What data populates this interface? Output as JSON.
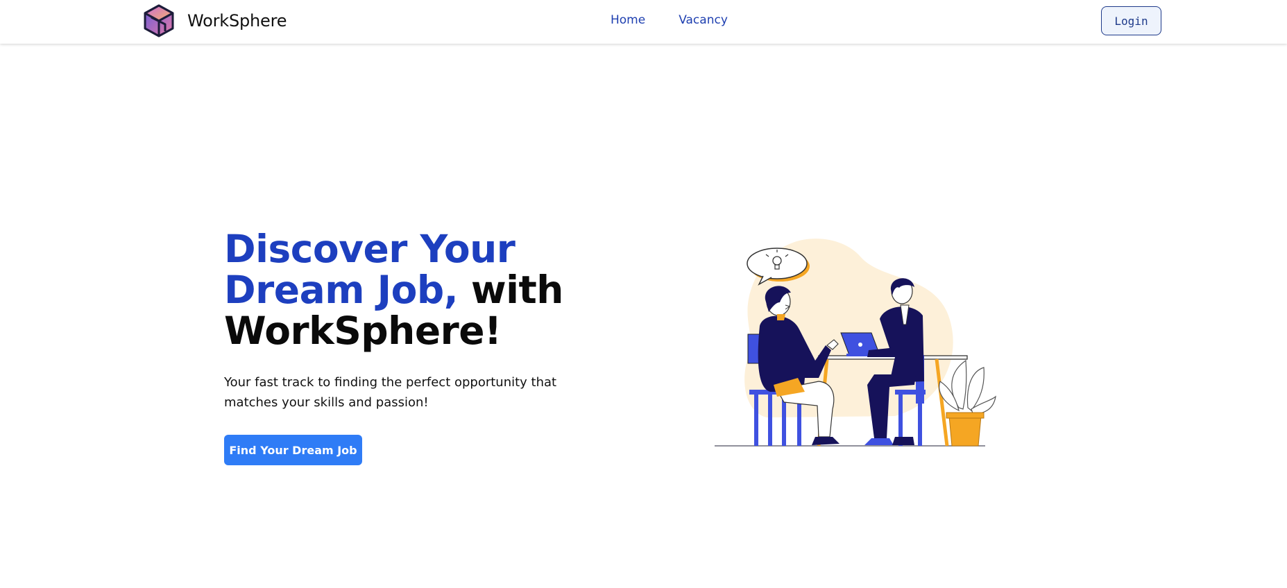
{
  "navbar": {
    "brand_name": "WorkSphere",
    "logo_icon": "cube-logo-icon",
    "links": [
      {
        "label": "Home"
      },
      {
        "label": "Vacancy"
      }
    ],
    "login_label": "Login"
  },
  "hero": {
    "headline_accent": "Discover Your Dream Job,",
    "headline_rest_1": "with",
    "headline_rest_2": "WorkSphere!",
    "subtitle": "Your fast track to finding the perfect opportunity that matches your skills and passion!",
    "cta_label": "Find Your Dream Job",
    "illustration": "job-interview-illustration"
  },
  "colors": {
    "accent_blue": "#1d3fbf",
    "cta_blue": "#2f7cf6",
    "illustration_orange": "#f5a623",
    "illustration_navy": "#16125a",
    "illustration_blob": "#fdf0d9"
  }
}
